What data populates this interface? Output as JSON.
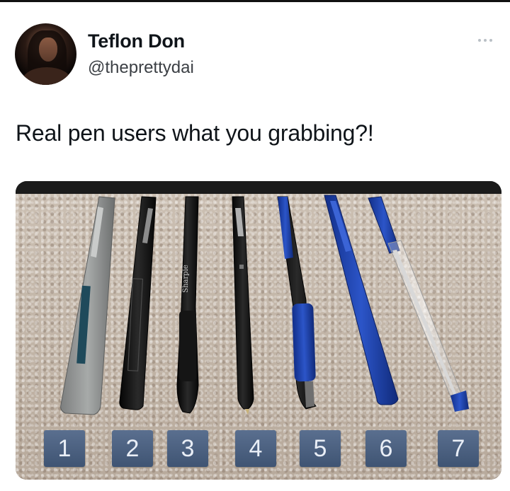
{
  "author": {
    "display_name": "Teflon Don",
    "handle": "@theprettydai"
  },
  "tweet": {
    "text": "Real pen users what you grabbing?!"
  },
  "media": {
    "pen_labels": [
      "1",
      "2",
      "3",
      "4",
      "5",
      "6",
      "7"
    ]
  },
  "icons": {
    "more": "more-horizontal-icon",
    "avatar": "avatar-image"
  }
}
